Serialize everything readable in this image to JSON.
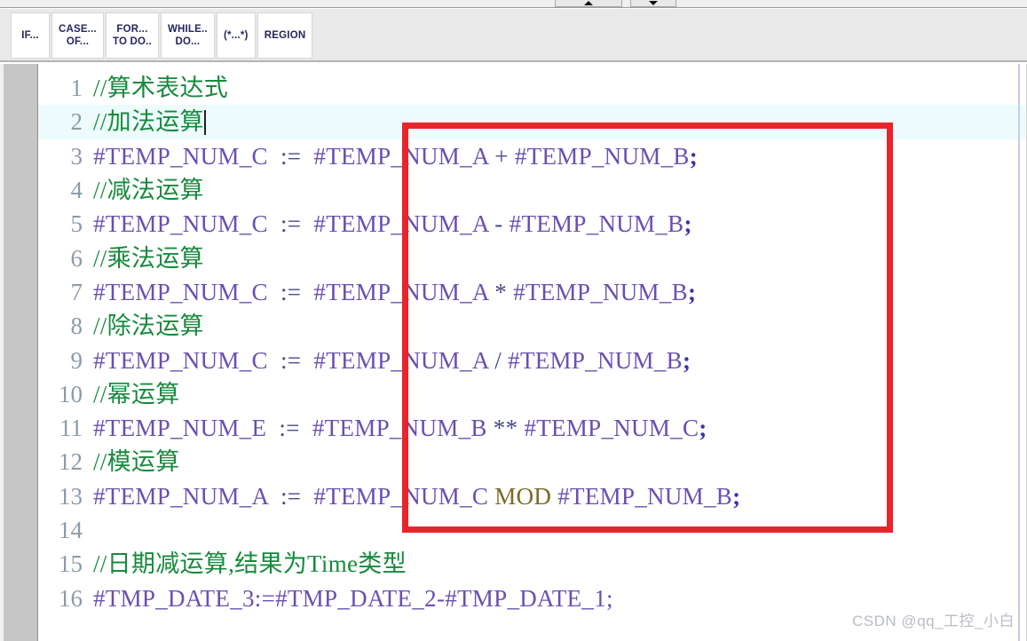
{
  "window": {
    "scroll_buttons": [
      {
        "name": "scroll-up-button",
        "glyph": "up-triangle-icon"
      },
      {
        "name": "scroll-down-button",
        "glyph": "down-triangle-icon"
      }
    ]
  },
  "toolbar": {
    "buttons": [
      {
        "line1": "IF...",
        "line2": ""
      },
      {
        "line1": "CASE...",
        "line2": "OF..."
      },
      {
        "line1": "FOR...",
        "line2": "TO DO.."
      },
      {
        "line1": "WHILE..",
        "line2": "DO..."
      },
      {
        "line1": "(*...*)",
        "line2": ""
      },
      {
        "line1": "REGION",
        "line2": ""
      }
    ]
  },
  "editor": {
    "current_line": 2,
    "colors": {
      "comment": "#168a3c",
      "hash": "#cf4fcf",
      "variable": "#6a4fb0",
      "operator": "#4a4a88",
      "keyword": "#7a6a22",
      "semicolon": "#3b2fb0",
      "current_line_bg": "#edfbfd",
      "gutter_bg": "#c6c6c6",
      "line_number": "#8e9aa8",
      "annotation_box": "#e8252a"
    },
    "lines": [
      {
        "n": "1",
        "type": "comment",
        "text": "//算术表达式"
      },
      {
        "n": "2",
        "type": "comment",
        "text": "//加法运算",
        "caret": true
      },
      {
        "n": "3",
        "type": "code",
        "lhs": "#TEMP_NUM_C",
        "assign": ":=",
        "a": "#TEMP_NUM_A",
        "op": "+",
        "b": "#TEMP_NUM_B",
        "end": ";"
      },
      {
        "n": "4",
        "type": "comment",
        "text": "//减法运算"
      },
      {
        "n": "5",
        "type": "code",
        "lhs": "#TEMP_NUM_C",
        "assign": ":=",
        "a": "#TEMP_NUM_A",
        "op": "-",
        "b": "#TEMP_NUM_B",
        "end": ";"
      },
      {
        "n": "6",
        "type": "comment",
        "text": "//乘法运算"
      },
      {
        "n": "7",
        "type": "code",
        "lhs": "#TEMP_NUM_C",
        "assign": ":=",
        "a": "#TEMP_NUM_A",
        "op": "*",
        "b": "#TEMP_NUM_B",
        "end": ";"
      },
      {
        "n": "8",
        "type": "comment",
        "text": "//除法运算"
      },
      {
        "n": "9",
        "type": "code",
        "lhs": "#TEMP_NUM_C",
        "assign": ":=",
        "a": "#TEMP_NUM_A",
        "op": "/",
        "b": "#TEMP_NUM_B",
        "end": ";"
      },
      {
        "n": "10",
        "type": "comment",
        "text": "//幂运算"
      },
      {
        "n": "11",
        "type": "code",
        "lhs": "#TEMP_NUM_E",
        "assign": ":=",
        "a": "#TEMP_NUM_B",
        "op": "**",
        "b": "#TEMP_NUM_C",
        "end": ";"
      },
      {
        "n": "12",
        "type": "comment",
        "text": "//模运算"
      },
      {
        "n": "13",
        "type": "code",
        "lhs": "#TEMP_NUM_A",
        "assign": ":=",
        "a": "#TEMP_NUM_C",
        "op": "MOD",
        "op_keyword": true,
        "b": "#TEMP_NUM_B",
        "end": ";"
      },
      {
        "n": "14",
        "type": "blank",
        "text": ""
      },
      {
        "n": "15",
        "type": "comment",
        "text": "//日期减运算,结果为Time类型"
      },
      {
        "n": "16",
        "type": "plain",
        "text": "#TMP_DATE_3:=#TMP_DATE_2-#TMP_DATE_1;"
      }
    ]
  },
  "watermark": {
    "text": "CSDN @qq_工控_小白"
  }
}
